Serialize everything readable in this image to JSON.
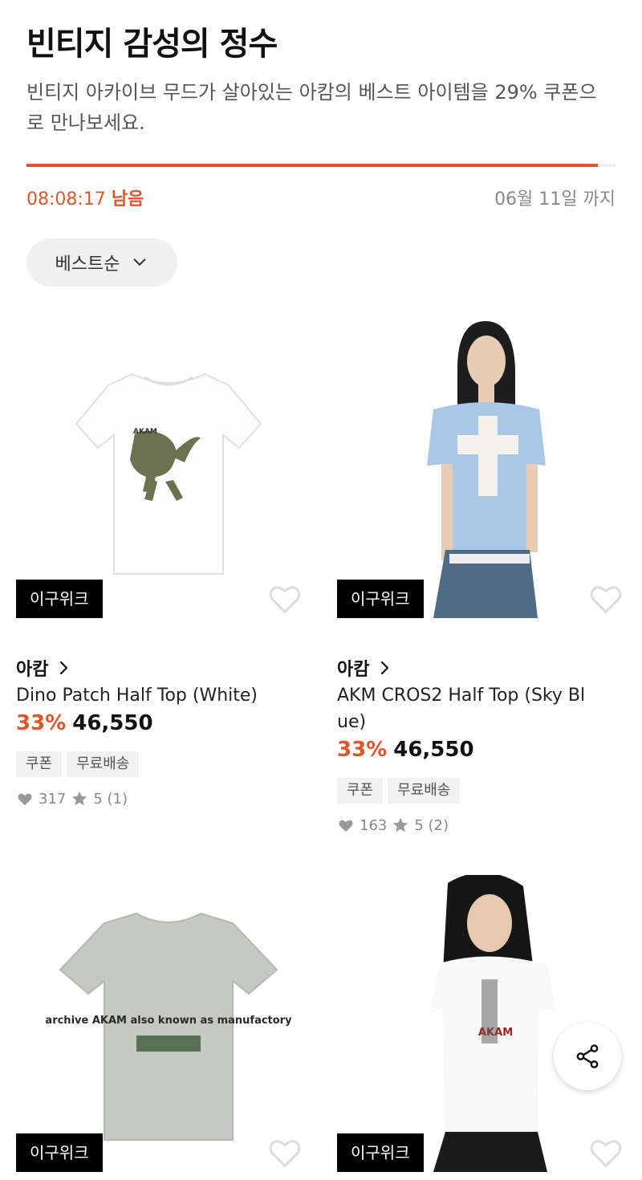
{
  "header": {
    "title": "빈티지 감성의 정수",
    "subtitle": "빈티지 아카이브 무드가 살아있는 아캄의 베스트 아이템을 29% 쿠폰으로 만나보세요.",
    "progress": 0.97,
    "timer": "08:08:17",
    "timer_suffix": "남음",
    "deadline": "06월 11일 까지"
  },
  "sort": {
    "label": "베스트순",
    "icon": "chevron-down-icon"
  },
  "products": [
    {
      "badge": "이구위크",
      "brand": "아캄",
      "name": "Dino Patch Half Top (White)",
      "discount": "33%",
      "price": "46,550",
      "tags": [
        "쿠폰",
        "무료배송"
      ],
      "likes": "317",
      "rating": "5 (1)"
    },
    {
      "badge": "이구위크",
      "brand": "아캄",
      "name": "AKM CROS2 Half Top (Sky Bl ue)",
      "discount": "33%",
      "price": "46,550",
      "tags": [
        "쿠폰",
        "무료배송"
      ],
      "likes": "163",
      "rating": "5 (2)"
    },
    {
      "badge": "이구위크"
    },
    {
      "badge": "이구위크"
    }
  ],
  "product_images": [
    {
      "printed": "AKAM"
    },
    {
      "printed": ""
    },
    {
      "printed": "archive AKAM also known as manufactory"
    },
    {
      "printed": "AKAM"
    }
  ],
  "colors": {
    "accent": "#e0562c",
    "badge_bg": "#000000",
    "tag_bg": "#f1f1f1"
  },
  "share": {
    "icon": "share-icon"
  }
}
